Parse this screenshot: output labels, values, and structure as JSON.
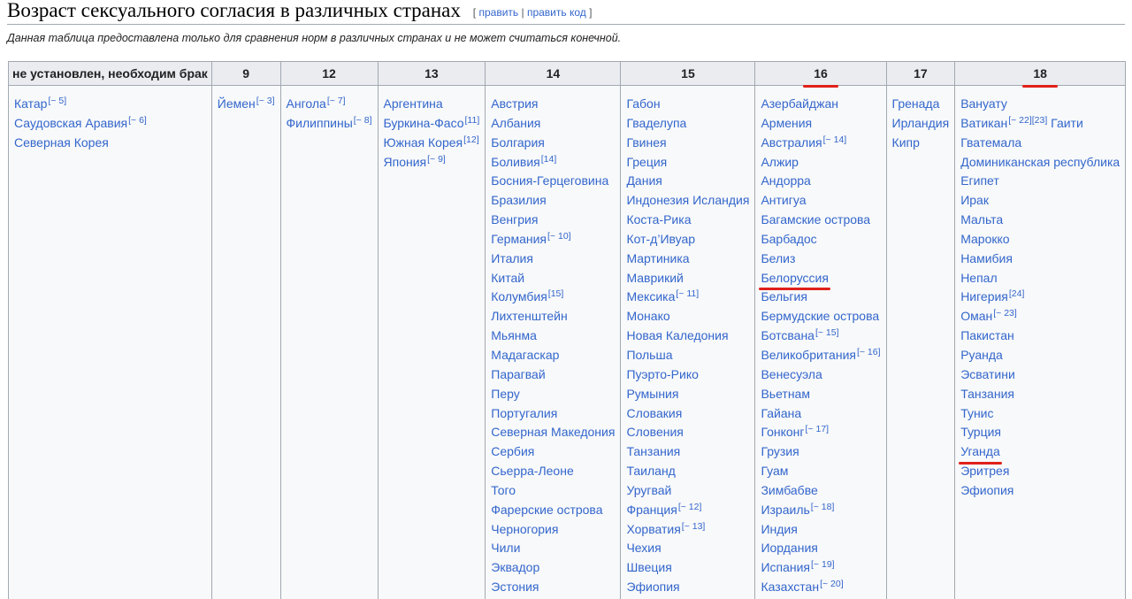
{
  "heading": {
    "title": "Возраст сексуального согласия в различных странах",
    "edit_open": "[",
    "edit_label": "править",
    "edit_sep": "|",
    "edit_code_label": "править код",
    "edit_close": "]"
  },
  "note": "Данная таблица предоставлена только для сравнения норм в различных странах и не может считаться конечной.",
  "accent_color": "#e0201b",
  "link_color": "#3366cc",
  "columns": [
    {
      "header": "не установлен, необходим брак",
      "countries": [
        {
          "name": "Катар",
          "ref": "[~ 5]"
        },
        {
          "name": "Саудовская Аравия",
          "ref": "[~ 6]"
        },
        {
          "name": "Северная Корея"
        }
      ]
    },
    {
      "header": "9",
      "countries": [
        {
          "name": "Йемен",
          "ref": "[~ 3]"
        }
      ]
    },
    {
      "header": "12",
      "countries": [
        {
          "name": "Ангола",
          "ref": "[~ 7]"
        },
        {
          "name": "Филиппины",
          "ref": "[~ 8]"
        }
      ]
    },
    {
      "header": "13",
      "countries": [
        {
          "name": "Аргентина"
        },
        {
          "name": "Буркина-Фасо",
          "ref": "[11]"
        },
        {
          "name": "Южная Корея",
          "ref": "[12]"
        },
        {
          "name": "Япония",
          "ref": "[~ 9]"
        }
      ]
    },
    {
      "header": "14",
      "countries": [
        {
          "name": "Австрия"
        },
        {
          "name": "Албания"
        },
        {
          "name": "Болгария"
        },
        {
          "name": "Боливия",
          "ref": "[14]"
        },
        {
          "name": "Босния-Герцеговина"
        },
        {
          "name": "Бразилия"
        },
        {
          "name": "Венгрия"
        },
        {
          "name": "Германия",
          "ref": "[~ 10]"
        },
        {
          "name": "Италия"
        },
        {
          "name": "Китай"
        },
        {
          "name": "Колумбия",
          "ref": "[15]"
        },
        {
          "name": "Лихтенштейн"
        },
        {
          "name": "Мьянма"
        },
        {
          "name": "Мадагаскар"
        },
        {
          "name": "Парагвай"
        },
        {
          "name": "Перу"
        },
        {
          "name": "Португалия"
        },
        {
          "name": "Северная Македония"
        },
        {
          "name": "Сербия"
        },
        {
          "name": "Сьерра-Леоне"
        },
        {
          "name": "Того"
        },
        {
          "name": "Фарерские острова"
        },
        {
          "name": "Черногория"
        },
        {
          "name": "Чили"
        },
        {
          "name": "Эквадор"
        },
        {
          "name": "Эстония"
        }
      ]
    },
    {
      "header": "15",
      "countries": [
        {
          "name": "Габон"
        },
        {
          "name": "Гваделупа"
        },
        {
          "name": "Гвинея"
        },
        {
          "name": "Греция"
        },
        {
          "name": "Дания"
        },
        {
          "name": "Индонезия Исландия"
        },
        {
          "name": "Коста-Рика"
        },
        {
          "name": "Кот-д’Ивуар"
        },
        {
          "name": "Мартиника"
        },
        {
          "name": "Маврикий"
        },
        {
          "name": "Мексика",
          "ref": "[~ 11]"
        },
        {
          "name": "Монако"
        },
        {
          "name": "Новая Каледония"
        },
        {
          "name": "Польша"
        },
        {
          "name": "Пуэрто-Рико"
        },
        {
          "name": "Румыния"
        },
        {
          "name": "Словакия"
        },
        {
          "name": "Словения"
        },
        {
          "name": "Танзания"
        },
        {
          "name": "Таиланд"
        },
        {
          "name": "Уругвай"
        },
        {
          "name": "Франция",
          "ref": "[~ 12]"
        },
        {
          "name": "Хорватия",
          "ref": "[~ 13]"
        },
        {
          "name": "Чехия"
        },
        {
          "name": "Швеция"
        },
        {
          "name": "Эфиопия"
        }
      ]
    },
    {
      "header": "16",
      "header_underlined": true,
      "countries": [
        {
          "name": "Азербайджан"
        },
        {
          "name": "Армения"
        },
        {
          "name": "Австралия",
          "ref": "[~ 14]"
        },
        {
          "name": "Алжир"
        },
        {
          "name": "Андорра"
        },
        {
          "name": "Антигуа"
        },
        {
          "name": "Багамские острова"
        },
        {
          "name": "Барбадос"
        },
        {
          "name": "Белиз"
        },
        {
          "name": "Белоруссия",
          "underlined": true
        },
        {
          "name": "Бельгия"
        },
        {
          "name": "Бермудские острова"
        },
        {
          "name": "Ботсвана",
          "ref": "[~ 15]"
        },
        {
          "name": "Великобритания",
          "ref": "[~ 16]"
        },
        {
          "name": "Венесуэла"
        },
        {
          "name": "Вьетнам"
        },
        {
          "name": "Гайана"
        },
        {
          "name": "Гонконг",
          "ref": "[~ 17]"
        },
        {
          "name": "Грузия"
        },
        {
          "name": "Гуам"
        },
        {
          "name": "Зимбабве"
        },
        {
          "name": "Израиль",
          "ref": "[~ 18]"
        },
        {
          "name": "Индия"
        },
        {
          "name": "Иордания"
        },
        {
          "name": "Испания",
          "ref": "[~ 19]"
        },
        {
          "name": "Казахстан",
          "ref": "[~ 20]"
        }
      ]
    },
    {
      "header": "17",
      "countries": [
        {
          "name": "Гренада"
        },
        {
          "name": "Ирландия"
        },
        {
          "name": "Кипр"
        }
      ]
    },
    {
      "header": "18",
      "header_underlined": true,
      "countries": [
        {
          "name": "Вануату"
        },
        {
          "name": "Ватикан",
          "ref": "[~ 22][23]",
          "tail": " Гаити"
        },
        {
          "name": "Гватемала"
        },
        {
          "name": "Доминиканская республика"
        },
        {
          "name": "Египет"
        },
        {
          "name": "Ирак"
        },
        {
          "name": "Мальта"
        },
        {
          "name": "Марокко"
        },
        {
          "name": "Намибия"
        },
        {
          "name": "Непал"
        },
        {
          "name": "Нигерия",
          "ref": "[24]"
        },
        {
          "name": "Оман",
          "ref": "[~ 23]"
        },
        {
          "name": "Пакистан"
        },
        {
          "name": "Руанда"
        },
        {
          "name": "Эсватини"
        },
        {
          "name": "Танзания"
        },
        {
          "name": "Тунис"
        },
        {
          "name": "Турция"
        },
        {
          "name": "Уганда",
          "underlined": true
        },
        {
          "name": "Эритрея"
        },
        {
          "name": "Эфиопия"
        }
      ]
    }
  ]
}
